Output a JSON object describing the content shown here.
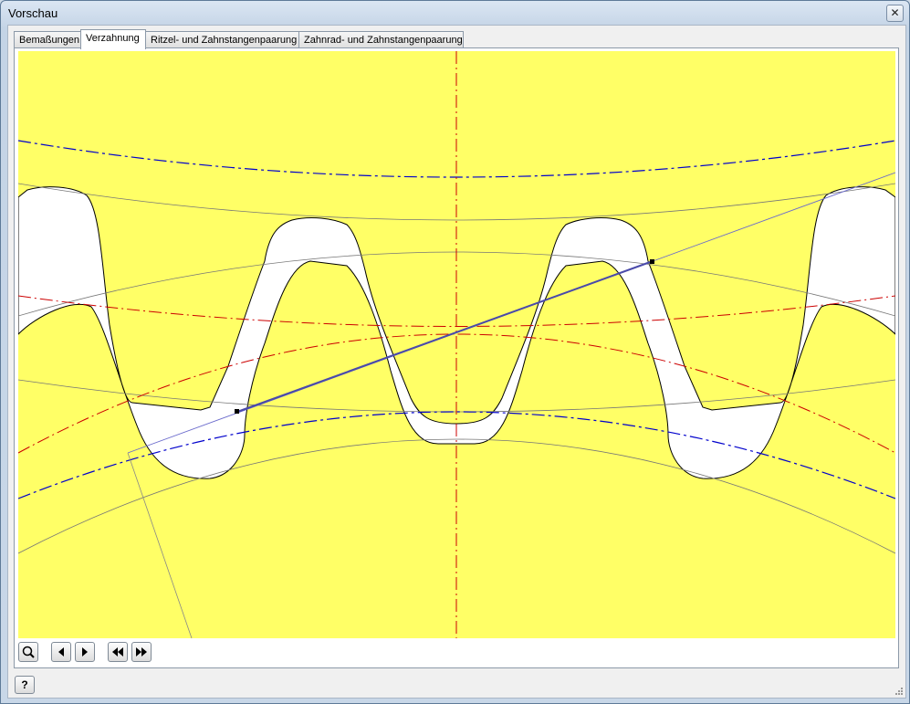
{
  "window": {
    "title": "Vorschau",
    "close_glyph": "✕"
  },
  "tabs": [
    {
      "label": "Bemaßungen",
      "active": false
    },
    {
      "label": "Verzahnung",
      "active": true
    },
    {
      "label": "Ritzel- und Zahnstangenpaarung",
      "active": false
    },
    {
      "label": "Zahnrad- und Zahnstangenpaarung",
      "active": false
    }
  ],
  "preview": {
    "background_color": "#ffff66",
    "tooth_fill": "#ffffff",
    "pitch_line_color": "#cc0000",
    "dashed_circle_color": "#0000cc",
    "action_line_color": "#6a6acc"
  },
  "toolbar": {
    "zoom_icon": "zoom-icon",
    "prev_icon": "arrow-left-icon",
    "next_icon": "arrow-right-icon",
    "first_icon": "double-arrow-left-icon",
    "last_icon": "double-arrow-right-icon"
  },
  "help": {
    "label": "?"
  }
}
